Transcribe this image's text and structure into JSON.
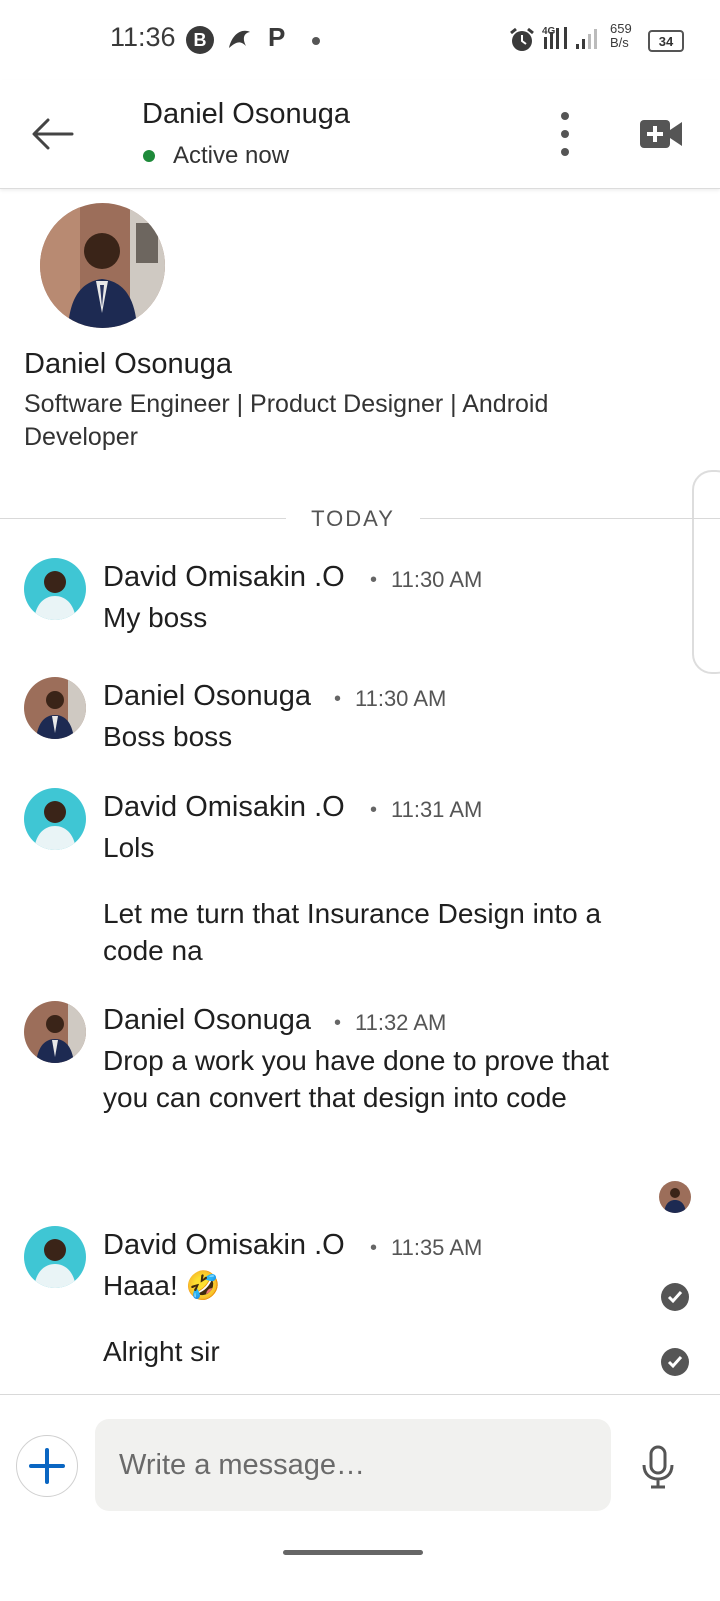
{
  "status_bar": {
    "time": "11:36",
    "b_icon_letter": "B",
    "p_icon_letter": "P",
    "net_speed_value": "659",
    "net_speed_unit": "B/s",
    "battery": "34"
  },
  "header": {
    "name": "Daniel Osonuga",
    "status": "Active now",
    "status_color": "#1e8a3a"
  },
  "profile": {
    "name": "Daniel Osonuga",
    "headline": "Software Engineer | Product Designer | Android Developer"
  },
  "day_divider": "TODAY",
  "messages": [
    {
      "sender": "David Omisakin .O",
      "time": "11:30 AM",
      "lines": [
        "My boss"
      ]
    },
    {
      "sender": "Daniel Osonuga",
      "time": "11:30 AM",
      "lines": [
        "Boss boss"
      ]
    },
    {
      "sender": "David Omisakin .O",
      "time": "11:31 AM",
      "lines": [
        "Lols",
        "Let me turn that Insurance Design into a code na"
      ]
    },
    {
      "sender": "Daniel Osonuga",
      "time": "11:32 AM",
      "lines": [
        "Drop a work you have done to prove that you can convert that design into code"
      ]
    },
    {
      "sender": "David Omisakin .O",
      "time": "11:35 AM",
      "lines": [
        "Haaa! 🤣",
        "Alright sir"
      ]
    }
  ],
  "compose": {
    "placeholder": "Write a message…"
  },
  "icons": {
    "back": "arrow-left-icon",
    "more": "more-vertical-icon",
    "video": "video-call-plus-icon",
    "plus": "plus-icon",
    "mic": "microphone-icon",
    "check": "check-circle-icon"
  },
  "colors": {
    "accent_blue": "#0a66c2",
    "online_green": "#1e8a3a"
  }
}
